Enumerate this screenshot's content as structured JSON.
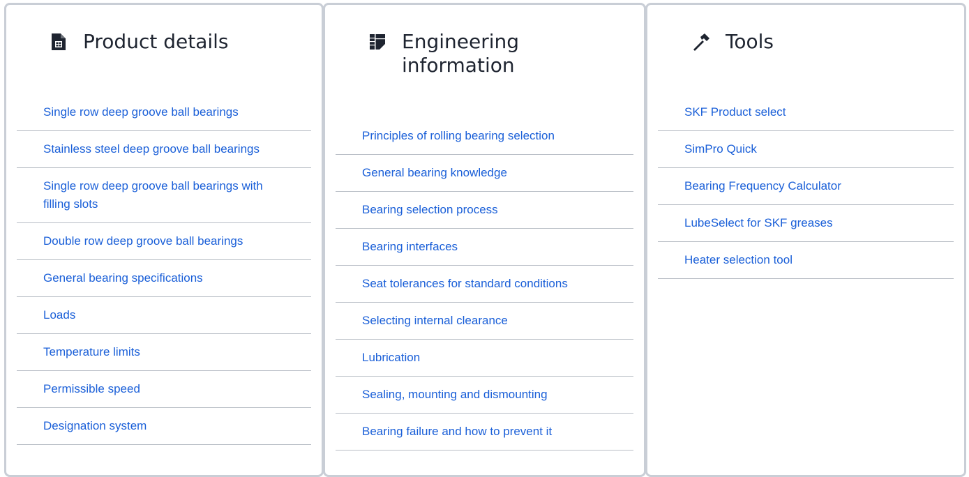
{
  "columns": [
    {
      "title": "Product details",
      "icon": "document-icon",
      "links": [
        "Single row deep groove ball bearings",
        "Stainless steel deep groove ball bearings",
        "Single row deep groove ball bearings with filling slots",
        "Double row deep groove ball bearings",
        "General bearing specifications",
        "Loads",
        "Temperature limits",
        "Permissible speed",
        "Designation system"
      ]
    },
    {
      "title": "Engineering information",
      "icon": "blueprint-icon",
      "links": [
        "Principles of rolling bearing selection",
        "General bearing knowledge",
        "Bearing selection process",
        "Bearing interfaces",
        "Seat tolerances for standard conditions",
        "Selecting internal clearance",
        "Lubrication",
        "Sealing, mounting and dismounting",
        "Bearing failure and how to prevent it"
      ]
    },
    {
      "title": "Tools",
      "icon": "hammer-icon",
      "links": [
        "SKF Product select",
        "SimPro Quick",
        "Bearing Frequency Calculator",
        "LubeSelect for SKF greases",
        "Heater selection tool"
      ]
    }
  ],
  "colors": {
    "link": "#1a5fd8",
    "heading": "#1e2430",
    "divider": "#b8bdc5",
    "border": "#c9ced6"
  }
}
